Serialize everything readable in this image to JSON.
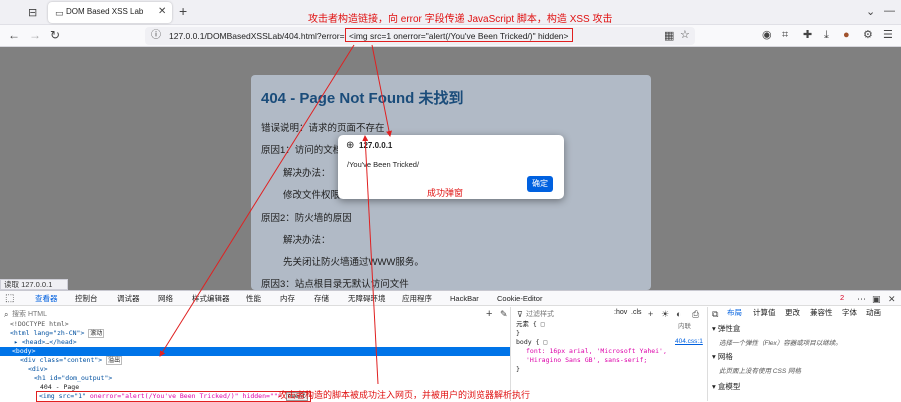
{
  "tab": {
    "title": "DOM Based XSS Lab"
  },
  "address": {
    "url": "127.0.0.1/DOMBasedXSSLab/404.html?error=",
    "payload": "<img src=1 onerror=\"alert(/You've Been Tricked/)\" hidden>"
  },
  "annotations": {
    "top": "攻击者构造链接，向 error 字段传递 JavaScript 脚本，构造 XSS 攻击",
    "popup": "成功弹窗",
    "bottom": "攻击者构造的脚本被成功注入网页，并被用户的浏览器解析执行"
  },
  "page": {
    "title": "404 - Page Not Found 未找到",
    "lines": [
      "错误说明：请求的页面不存在",
      "原因1：访问的文档",
      "解决办法：",
      "修改文件权限",
      "原因2：防火墙的原因",
      "解决办法：",
      "先关闭让防火墙通过WWW服务。",
      "原因3：站点根目录无默认访问文件"
    ]
  },
  "dialog": {
    "origin": "127.0.0.1",
    "message": "/You've Been Tricked/",
    "ok": "确定"
  },
  "status": "读取 127.0.0.1",
  "devtools": {
    "tabs": [
      "查看器",
      "控制台",
      "调试器",
      "网络",
      "样式编辑器",
      "性能",
      "内存",
      "存储",
      "无障碍环境",
      "应用程序",
      "HackBar",
      "Cookie-Editor"
    ],
    "error_count": "2",
    "search_placeholder": "搜索 HTML",
    "filter_placeholder": "过滤样式",
    "hov": ":hov",
    "cls": ".cls",
    "right_tabs": [
      "布局",
      "计算值",
      "更改",
      "兼容性",
      "字体",
      "动画"
    ],
    "tree": {
      "doctype": "<!DOCTYPE html>",
      "html": "<html lang=\"zh-CN\">",
      "scroll_badge": "滚动",
      "head": "<head>",
      "head_close": "</head>",
      "body": "<body>",
      "div": "<div class=\"content\">",
      "overflow_badge": "溢出",
      "div2": "<div>",
      "h1": "<h1 id=\"dom_output\">",
      "text": "404 - Page",
      "img_open": "<img src=\"1\"",
      "img_attr": "onerror=\"alert(/You've Been Tricked/)\"",
      "img_hidden": "hidden=\"\">",
      "event_badge": "event"
    },
    "rules": {
      "element": "元素 {",
      "close": "}",
      "inline": "内联",
      "body_sel": "body {",
      "source": "404.css:1",
      "font": "font: 16px arial, 'Microsoft Yahei', 'Hiragino Sans GB', sans-serif;"
    },
    "layout": {
      "flex": "弹性盒",
      "flex_hint": "选择一个弹性（Flex）容器或项目以继续。",
      "grid": "网格",
      "grid_hint": "此页面上没有使用 CSS 网格",
      "box": "盒模型"
    }
  }
}
